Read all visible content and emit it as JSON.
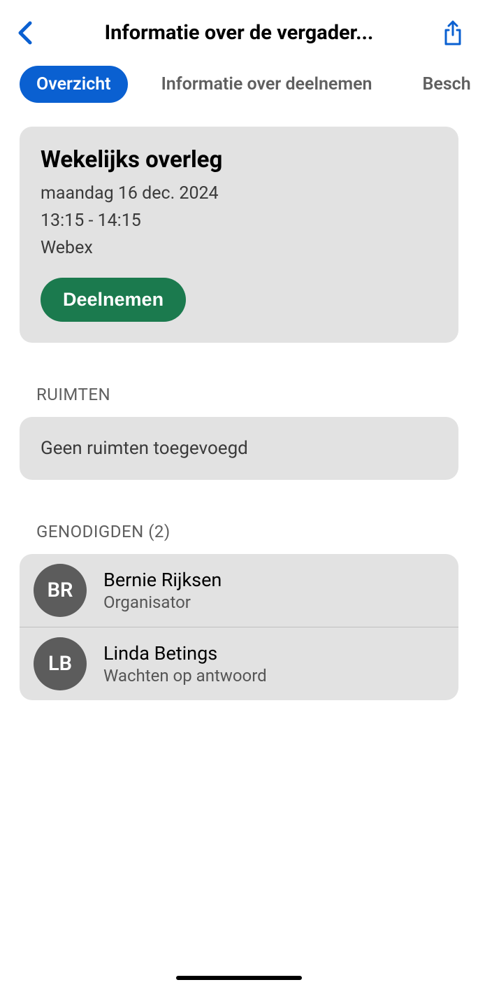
{
  "header": {
    "title": "Informatie over de vergader..."
  },
  "tabs": {
    "items": [
      {
        "label": "Overzicht",
        "active": true
      },
      {
        "label": "Informatie over deelnemen",
        "active": false
      },
      {
        "label": "Besch",
        "active": false
      }
    ]
  },
  "meeting": {
    "title": "Wekelijks overleg",
    "date": "maandag 16 dec. 2024",
    "time": "13:15 - 14:15",
    "platform": "Webex",
    "join_label": "Deelnemen"
  },
  "rooms": {
    "header": "RUIMTEN",
    "empty_text": "Geen ruimten toegevoegd"
  },
  "invitees": {
    "header": "GENODIGDEN (2)",
    "list": [
      {
        "initials": "BR",
        "name": "Bernie Rijksen",
        "role": "Organisator"
      },
      {
        "initials": "LB",
        "name": "Linda Betings",
        "role": "Wachten op antwoord"
      }
    ]
  },
  "colors": {
    "primary": "#0a60d1",
    "join": "#1b7a4e"
  }
}
